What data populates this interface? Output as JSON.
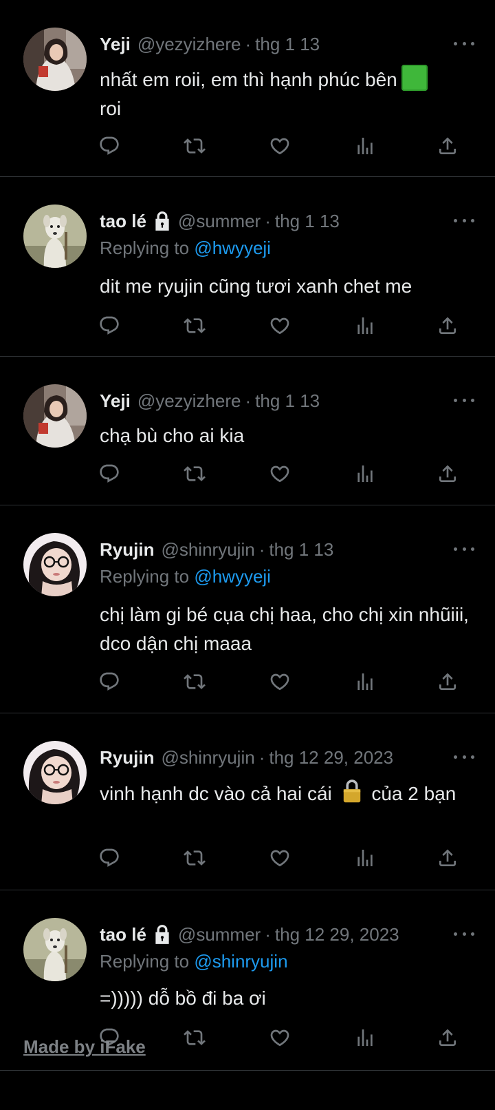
{
  "tweets": [
    {
      "name": "Yeji",
      "locked": false,
      "handle": "@yezyizhere",
      "dot": "·",
      "time": "thg 1 13",
      "replying_prefix": "",
      "replying_to": "",
      "text_1": "nhất em roii, em thì hạnh phúc bên",
      "emoji": "green-square",
      "text_2": "roi",
      "avatar": "girl-hoodie"
    },
    {
      "name": "tao lé",
      "locked": true,
      "handle": "@summer",
      "dot": "·",
      "time": "thg 1 13",
      "replying_prefix": "Replying to",
      "replying_to": "@hwyyeji",
      "text": "dit me ryujin cũng tươi xanh chet me",
      "avatar": "white-dog"
    },
    {
      "name": "Yeji",
      "locked": false,
      "handle": "@yezyizhere",
      "dot": "·",
      "time": "thg 1 13",
      "text": "chạ bù cho ai kia",
      "avatar": "girl-hoodie"
    },
    {
      "name": "Ryujin",
      "locked": false,
      "handle": "@shinryujin",
      "dot": "·",
      "time": "thg 1 13",
      "replying_prefix": "Replying to",
      "replying_to": "@hwyyeji",
      "text": "chị làm gi bé cụa chị haa, cho chị xin nhũiii, dco dận chị maaa",
      "avatar": "girl-glasses"
    },
    {
      "name": "Ryujin",
      "locked": false,
      "handle": "@shinryujin",
      "dot": "·",
      "time": "thg 12 29, 2023",
      "text_1": "vinh hạnh dc vào cả hai cái",
      "emoji": "lock",
      "text_2": "của 2 bạn",
      "avatar": "girl-glasses"
    },
    {
      "name": "tao lé",
      "locked": true,
      "handle": "@summer",
      "dot": "·",
      "time": "thg 12 29, 2023",
      "replying_prefix": "Replying to",
      "replying_to": "@shinryujin",
      "text": "=))))) dỗ bồ đi ba ơi",
      "avatar": "white-dog"
    }
  ],
  "actions": [
    "reply-icon",
    "retweet-icon",
    "like-icon",
    "views-icon",
    "share-icon"
  ],
  "watermark": "Made by iFake",
  "colors": {
    "background": "#000000",
    "text": "#e7e9ea",
    "muted": "#71767b",
    "link": "#1d9bf0",
    "divider": "#2f3336"
  }
}
